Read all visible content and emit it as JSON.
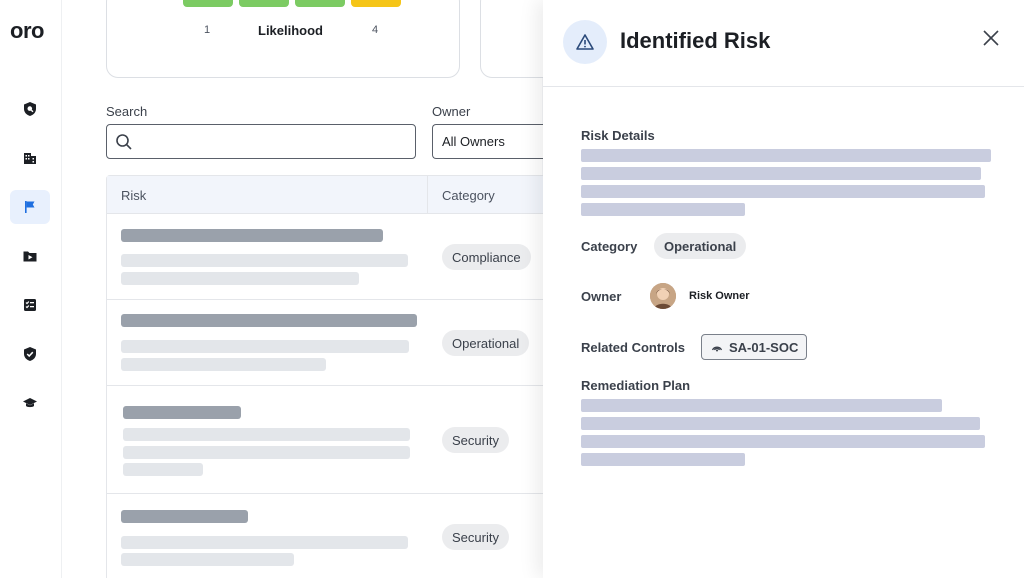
{
  "brand": {
    "logo": "oro"
  },
  "nav": {
    "items": [
      {
        "icon": "shield-search-icon"
      },
      {
        "icon": "building-icon"
      },
      {
        "icon": "flag-icon",
        "active": true
      },
      {
        "icon": "folder-play-icon"
      },
      {
        "icon": "checklist-icon"
      },
      {
        "icon": "shield-check-icon"
      },
      {
        "icon": "graduation-cap-icon"
      }
    ]
  },
  "heatmap": {
    "colors": [
      "#7ccb63",
      "#7ccb63",
      "#7ccb63",
      "#f5c518"
    ],
    "axis_label": "Likelihood",
    "min": "1",
    "max": "4"
  },
  "filters": {
    "search_label": "Search",
    "search_value": "",
    "owner_label": "Owner",
    "owner_value": "All Owners"
  },
  "table": {
    "columns": [
      "Risk",
      "Category"
    ],
    "rows": [
      {
        "category": "Compliance"
      },
      {
        "category": "Operational"
      },
      {
        "category": "Security"
      },
      {
        "category": "Security"
      }
    ]
  },
  "panel": {
    "title": "Identified Risk",
    "details_label": "Risk Details",
    "category_label": "Category",
    "category_value": "Operational",
    "owner_label": "Owner",
    "owner_name": "Risk Owner",
    "controls_label": "Related Controls",
    "control_id": "SA-01-SOC",
    "remediation_label": "Remediation Plan"
  },
  "colors": {
    "accent": "#1f6fe0",
    "skeleton_dark": "#9aa1ab",
    "skeleton_light": "#e3e6ea",
    "skeleton_panel": "#c9cddf"
  }
}
